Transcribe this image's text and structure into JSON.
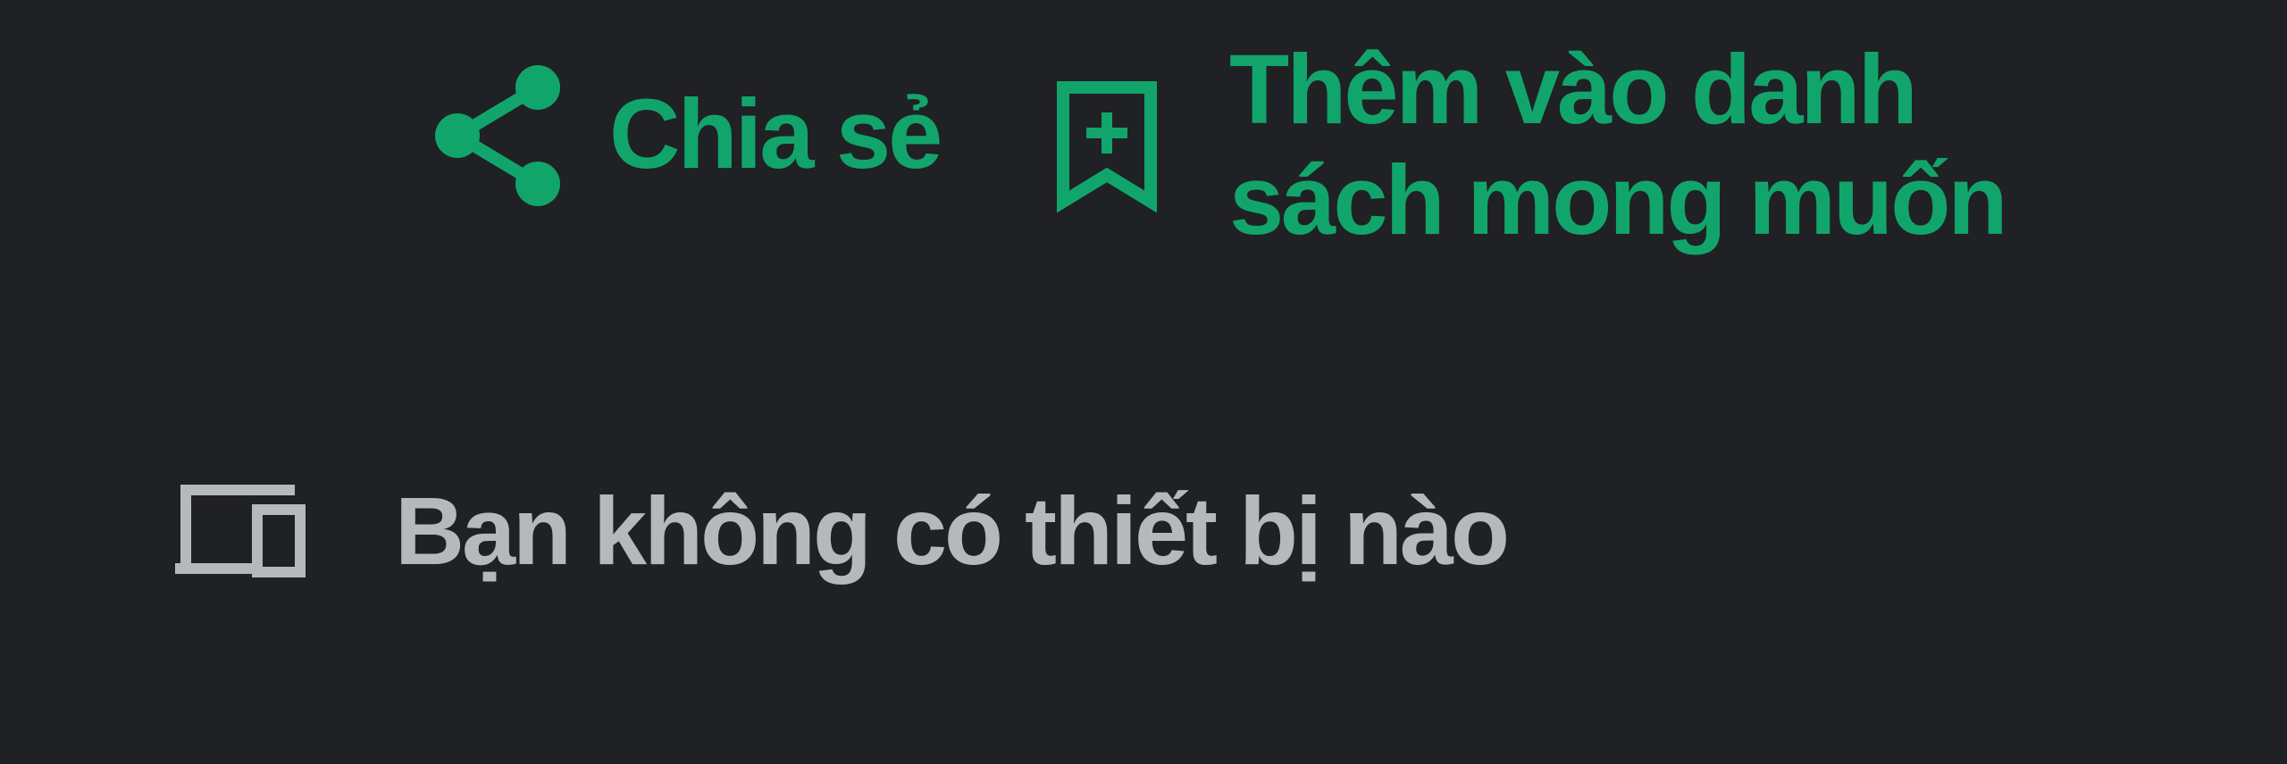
{
  "actions": {
    "share": {
      "label": "Chia sẻ",
      "icon": "share-icon"
    },
    "wishlist": {
      "label": "Thêm vào danh sách mong muốn",
      "icon": "bookmark-add-icon"
    }
  },
  "devices": {
    "label": "Bạn không có thiết bị nào",
    "icon": "devices-icon"
  },
  "colors": {
    "background": "#202124",
    "accent": "#11a56c",
    "muted_text": "#b5b8bd"
  }
}
